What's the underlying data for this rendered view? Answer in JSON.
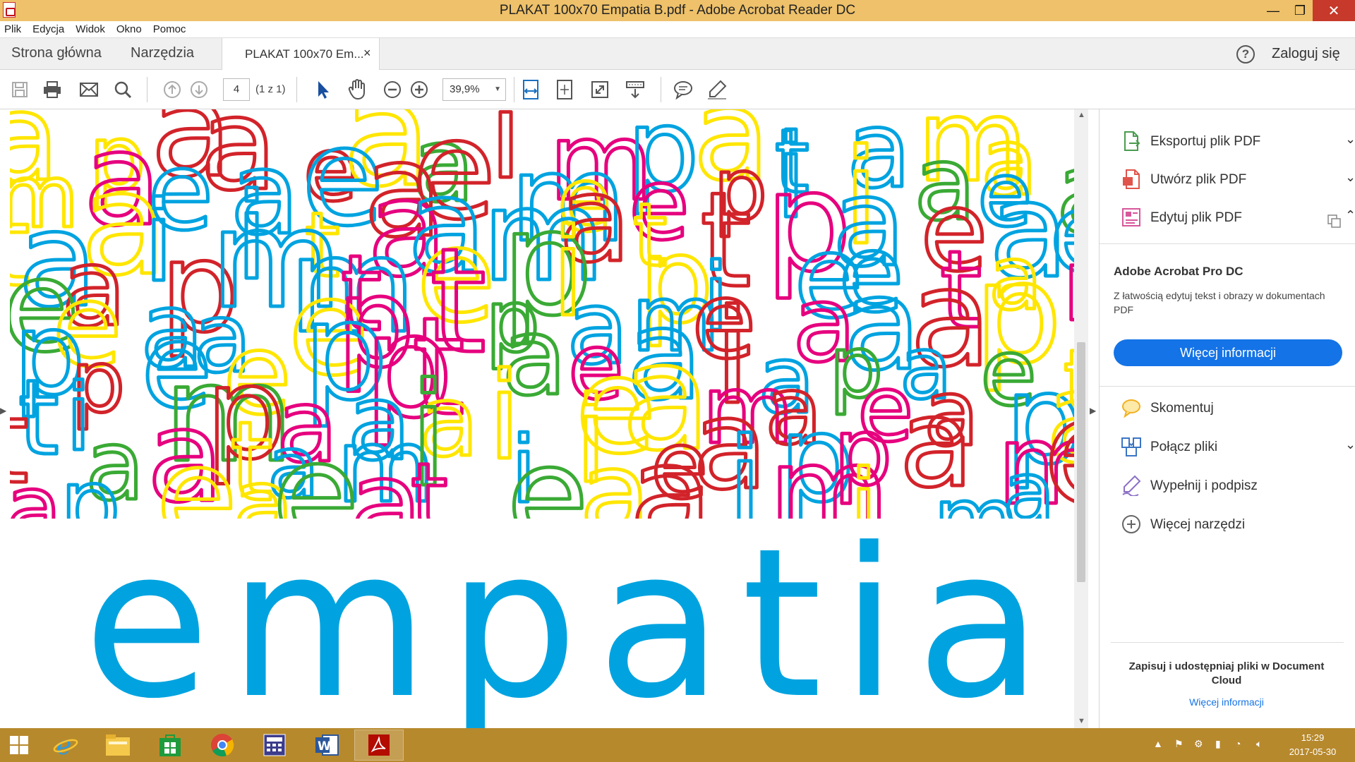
{
  "window": {
    "title": "PLAKAT 100x70 Empatia B.pdf - Adobe Acrobat Reader DC",
    "minimize_glyph": "—",
    "maximize_glyph": "❐",
    "close_glyph": "✕"
  },
  "menu": {
    "items": [
      "Plik",
      "Edycja",
      "Widok",
      "Okno",
      "Pomoc"
    ]
  },
  "nav": {
    "home": "Strona główna",
    "tools": "Narzędzia",
    "doc_tab": "PLAKAT 100x70 Em...",
    "doc_tab_close": "×",
    "help": "?",
    "signin": "Zaloguj się"
  },
  "toolbar": {
    "page_value": "4",
    "page_count": "(1 z 1)",
    "zoom_value": "39,9%",
    "icons": [
      "save-icon",
      "print-icon",
      "email-icon",
      "search-icon",
      "prev-page-icon",
      "next-page-icon",
      "select-cursor-icon",
      "hand-icon",
      "zoom-out-icon",
      "zoom-in-icon",
      "fit-page-icon",
      "fit-width-icon",
      "fullscreen-icon",
      "scroll-mode-icon",
      "comment-icon",
      "highlight-pen-icon"
    ]
  },
  "document": {
    "big_word": "empatia",
    "colors": {
      "blue": "#00a3e0",
      "red": "#d2232a",
      "magenta": "#e6007e",
      "yellow": "#ffe600",
      "green": "#3aaa35"
    }
  },
  "right_pane": {
    "tools": [
      {
        "label": "Eksportuj plik PDF",
        "chevron": "⌄",
        "icon": "export-pdf-icon"
      },
      {
        "label": "Utwórz plik PDF",
        "chevron": "⌄",
        "icon": "create-pdf-icon"
      },
      {
        "label": "Edytuj plik PDF",
        "chevron": "⌃",
        "icon": "edit-pdf-icon"
      }
    ],
    "promo_title": "Adobe Acrobat Pro DC",
    "promo_desc": "Z łatwością edytuj tekst i obrazy w dokumentach PDF",
    "promo_button": "Więcej informacji",
    "tools2": [
      {
        "label": "Skomentuj",
        "icon": "comment-tool-icon"
      },
      {
        "label": "Połącz pliki",
        "chevron": "⌄",
        "icon": "combine-files-icon"
      },
      {
        "label": "Wypełnij i podpisz",
        "icon": "fill-sign-icon"
      },
      {
        "label": "Więcej narzędzi",
        "icon": "more-tools-icon"
      }
    ],
    "cloud_text": "Zapisuj i udostępniaj pliki w Document Cloud",
    "cloud_link": "Więcej informacji"
  },
  "taskbar": {
    "time": "15:29",
    "date": "2017-05-30",
    "apps": [
      "internet-explorer-icon",
      "file-explorer-icon",
      "store-icon",
      "chrome-icon",
      "calculator-icon",
      "word-icon",
      "acrobat-icon"
    ]
  }
}
